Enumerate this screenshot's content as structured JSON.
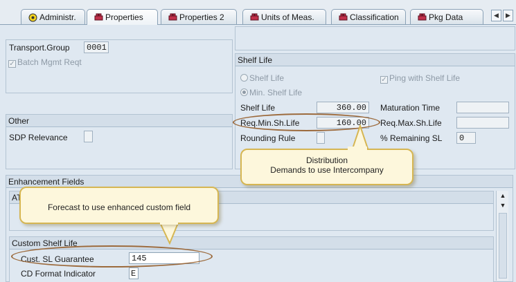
{
  "tabs": [
    {
      "label": "Administr.",
      "icon": "checkmark-circle-icon",
      "active": false
    },
    {
      "label": "Properties",
      "icon": "lego-brick-icon",
      "active": true
    },
    {
      "label": "Properties 2",
      "icon": "lego-brick-icon",
      "active": false
    },
    {
      "label": "Units of Meas.",
      "icon": "lego-brick-icon",
      "active": false
    },
    {
      "label": "Classification",
      "icon": "lego-brick-icon",
      "active": false
    },
    {
      "label": "Pkg Data",
      "icon": "lego-brick-icon",
      "active": false
    }
  ],
  "general": {
    "transport_group_label": "Transport.Group",
    "transport_group_value": "0001",
    "batch_mgmt_label": "Batch Mgmt Reqt"
  },
  "other": {
    "title": "Other",
    "sdp_relevance_label": "SDP Relevance"
  },
  "shelf_life": {
    "title": "Shelf Life",
    "radio_shelf_life": "Shelf Life",
    "radio_min_shelf_life": "Min. Shelf Life",
    "ping_label": "Ping with Shelf Life",
    "shelf_life_label": "Shelf Life",
    "shelf_life_value": "360.00",
    "maturation_label": "Maturation Time",
    "req_min_label": "Req.Min.Sh.Life",
    "req_min_value": "160.00",
    "req_max_label": "Req.Max.Sh.Life",
    "rounding_label": "Rounding Rule",
    "remaining_label": "% Remaining SL",
    "remaining_value": "0"
  },
  "enhancement": {
    "title": "Enhancement Fields",
    "subgroup_title": "AT"
  },
  "custom_shelf_life": {
    "title": "Custom Shelf Life",
    "guarantee_label": "Cust. SL Guarantee",
    "guarantee_value": "145",
    "cd_format_label": "CD Format Indicator",
    "cd_format_value": "E"
  },
  "callouts": {
    "distribution_line1": "Distribution",
    "distribution_line2": "Demands to use Intercompany",
    "forecast": "Forecast to use enhanced custom field"
  },
  "colors": {
    "background": "#dfe8f1",
    "callout_fill": "#fdf7dc",
    "callout_border": "#d6b652",
    "highlight_ellipse": "#9c6a3c"
  }
}
